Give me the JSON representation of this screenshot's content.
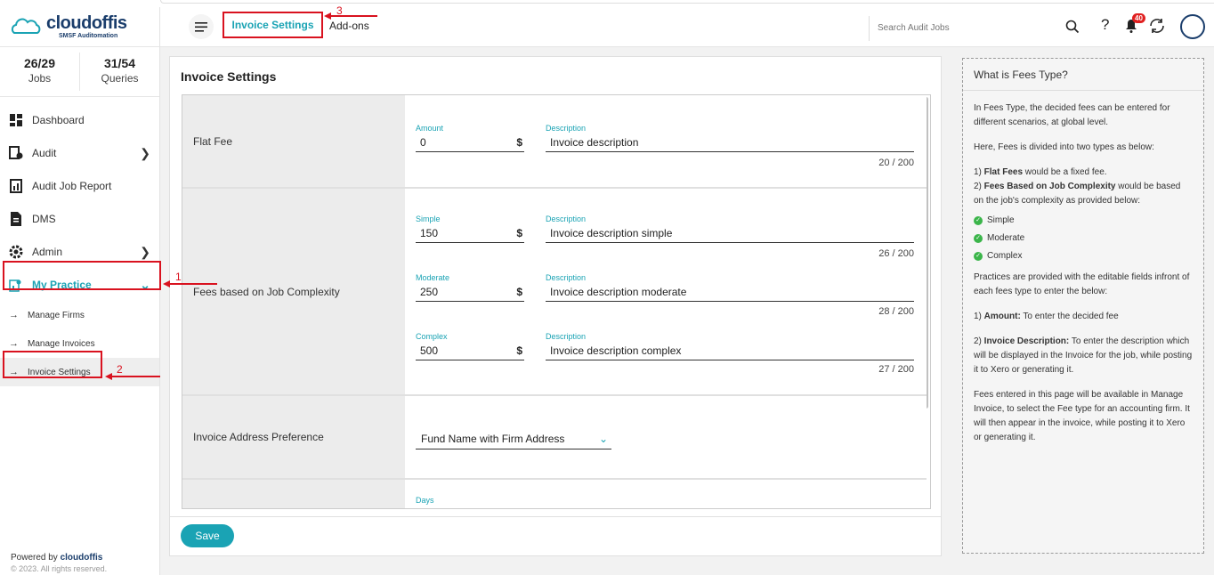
{
  "app": {
    "brand": "cloudoffis",
    "tagline": "SMSF Auditomation"
  },
  "stats": [
    {
      "value": "26/29",
      "label": "Jobs"
    },
    {
      "value": "31/54",
      "label": "Queries"
    }
  ],
  "sidebar": {
    "items": [
      {
        "label": "Dashboard"
      },
      {
        "label": "Audit"
      },
      {
        "label": "Audit Job Report"
      },
      {
        "label": "DMS"
      },
      {
        "label": "Admin"
      },
      {
        "label": "My Practice"
      }
    ],
    "subitems": [
      {
        "label": "Manage Firms"
      },
      {
        "label": "Manage Invoices"
      },
      {
        "label": "Invoice Settings"
      }
    ],
    "footer": {
      "powered": "Powered by",
      "brand": "cloudoffis",
      "copyright": "© 2023. All rights reserved."
    }
  },
  "header": {
    "active_tab": "Invoice Settings",
    "tab2": "Add-ons",
    "search_placeholder": "Search Audit Jobs",
    "notification_count": "40"
  },
  "main": {
    "title": "Invoice Settings",
    "rows": {
      "flat": {
        "label": "Flat Fee",
        "amount_label": "Amount",
        "amount": "0",
        "desc_label": "Description",
        "desc": "Invoice description",
        "counter": "20 / 200"
      },
      "complexity": {
        "label": "Fees based on Job Complexity",
        "simple_label": "Simple",
        "simple": "150",
        "simple_desc_label": "Description",
        "simple_desc": "Invoice description simple",
        "simple_counter": "26 / 200",
        "moderate_label": "Moderate",
        "moderate": "250",
        "moderate_desc_label": "Description",
        "moderate_desc": "Invoice description moderate",
        "moderate_counter": "28 / 200",
        "complex_label": "Complex",
        "complex": "500",
        "complex_desc_label": "Description",
        "complex_desc": "Invoice description complex",
        "complex_counter": "27 / 200"
      },
      "address": {
        "label": "Invoice Address Preference",
        "value": "Fund Name with Firm Address"
      },
      "days": {
        "days_label": "Days"
      }
    },
    "currency": "$",
    "save_label": "Save"
  },
  "help": {
    "title": "What is Fees Type?",
    "p1": "In Fees Type, the decided fees can be entered for different scenarios, at global level.",
    "p2": "Here, Fees is divided into two types as below:",
    "p3_n1": "1) ",
    "p3_flat": "Flat Fees",
    "p3_flat_rest": " would be a fixed fee.",
    "p3_n2": "2) ",
    "p3_job": "Fees Based on Job Complexity",
    "p3_job_rest": " would be based on the job's complexity as provided below:",
    "levels": [
      "Simple",
      "Moderate",
      "Complex"
    ],
    "p4": "Practices are provided with the editable fields infront of each fees type to enter the below:",
    "p5_n": "1) ",
    "p5_b": "Amount:",
    "p5_rest": " To enter the decided fee",
    "p6_n": "2) ",
    "p6_b": "Invoice Description:",
    "p6_rest": " To enter the description which will be displayed in the Invoice for the job, while posting it to Xero or generating it.",
    "p7": "Fees entered in this page will be available in Manage Invoice, to select the Fee type for an accounting firm. It will then appear in the invoice, while posting it to Xero or generating it."
  },
  "annotations": [
    "1",
    "2",
    "3"
  ],
  "colors": {
    "accent": "#1aa3b4",
    "annotation": "#d9121f",
    "brand": "#1a3d6b"
  }
}
